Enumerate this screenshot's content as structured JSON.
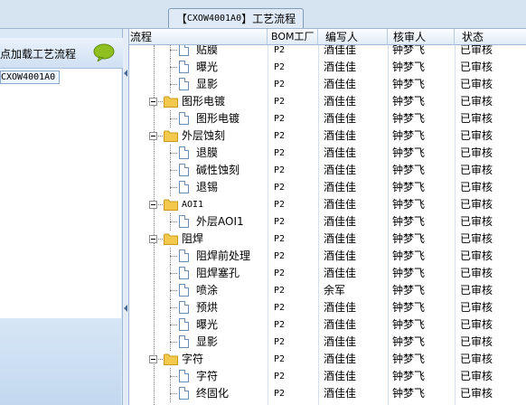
{
  "window": {
    "title_prefix": "【",
    "title_code": "CXOW4001A0",
    "title_suffix": "】工艺流程"
  },
  "left_panel": {
    "header_text": "点加载工艺流程",
    "item_code": "CXOW4001A0"
  },
  "grid": {
    "columns": [
      "流程",
      "BOM工厂",
      "编写人",
      "核审人",
      "状态"
    ],
    "rows": [
      {
        "name": "贴膜",
        "type": "item",
        "bom": "P2",
        "writer": "酒佳佳",
        "reviewer": "钟梦飞",
        "status": "已审核"
      },
      {
        "name": "曝光",
        "type": "item",
        "bom": "P2",
        "writer": "酒佳佳",
        "reviewer": "钟梦飞",
        "status": "已审核"
      },
      {
        "name": "显影",
        "type": "item",
        "bom": "P2",
        "writer": "酒佳佳",
        "reviewer": "钟梦飞",
        "status": "已审核"
      },
      {
        "name": "图形电镀",
        "type": "folder",
        "bom": "P2",
        "writer": "酒佳佳",
        "reviewer": "钟梦飞",
        "status": "已审核"
      },
      {
        "name": "图形电镀",
        "type": "item",
        "bom": "P2",
        "writer": "酒佳佳",
        "reviewer": "钟梦飞",
        "status": "已审核"
      },
      {
        "name": "外层蚀刻",
        "type": "folder",
        "bom": "P2",
        "writer": "酒佳佳",
        "reviewer": "钟梦飞",
        "status": "已审核"
      },
      {
        "name": "退膜",
        "type": "item",
        "bom": "P2",
        "writer": "酒佳佳",
        "reviewer": "钟梦飞",
        "status": "已审核"
      },
      {
        "name": "碱性蚀刻",
        "type": "item",
        "bom": "P2",
        "writer": "酒佳佳",
        "reviewer": "钟梦飞",
        "status": "已审核"
      },
      {
        "name": "退锡",
        "type": "item",
        "bom": "P2",
        "writer": "酒佳佳",
        "reviewer": "钟梦飞",
        "status": "已审核"
      },
      {
        "name": "AOI1",
        "type": "folder",
        "bom": "P2",
        "writer": "酒佳佳",
        "reviewer": "钟梦飞",
        "status": "已审核"
      },
      {
        "name": "外层AOI1",
        "type": "item",
        "bom": "P2",
        "writer": "酒佳佳",
        "reviewer": "钟梦飞",
        "status": "已审核"
      },
      {
        "name": "阻焊",
        "type": "folder",
        "bom": "P2",
        "writer": "酒佳佳",
        "reviewer": "钟梦飞",
        "status": "已审核"
      },
      {
        "name": "阻焊前处理",
        "type": "item",
        "bom": "P2",
        "writer": "酒佳佳",
        "reviewer": "钟梦飞",
        "status": "已审核"
      },
      {
        "name": "阻焊塞孔",
        "type": "item",
        "bom": "P2",
        "writer": "酒佳佳",
        "reviewer": "钟梦飞",
        "status": "已审核"
      },
      {
        "name": "喷涂",
        "type": "item",
        "bom": "P2",
        "writer": "余军",
        "reviewer": "钟梦飞",
        "status": "已审核"
      },
      {
        "name": "预烘",
        "type": "item",
        "bom": "P2",
        "writer": "酒佳佳",
        "reviewer": "钟梦飞",
        "status": "已审核"
      },
      {
        "name": "曝光",
        "type": "item",
        "bom": "P2",
        "writer": "酒佳佳",
        "reviewer": "钟梦飞",
        "status": "已审核"
      },
      {
        "name": "显影",
        "type": "item",
        "bom": "P2",
        "writer": "酒佳佳",
        "reviewer": "钟梦飞",
        "status": "已审核"
      },
      {
        "name": "字符",
        "type": "folder",
        "bom": "P2",
        "writer": "酒佳佳",
        "reviewer": "钟梦飞",
        "status": "已审核"
      },
      {
        "name": "字符",
        "type": "item",
        "bom": "P2",
        "writer": "酒佳佳",
        "reviewer": "钟梦飞",
        "status": "已审核"
      },
      {
        "name": "终固化",
        "type": "item",
        "bom": "P2",
        "writer": "酒佳佳",
        "reviewer": "钟梦飞",
        "status": "已审核"
      }
    ]
  },
  "colors": {
    "folder": "#f2c94c",
    "chat_icon": "#8fbf21"
  }
}
